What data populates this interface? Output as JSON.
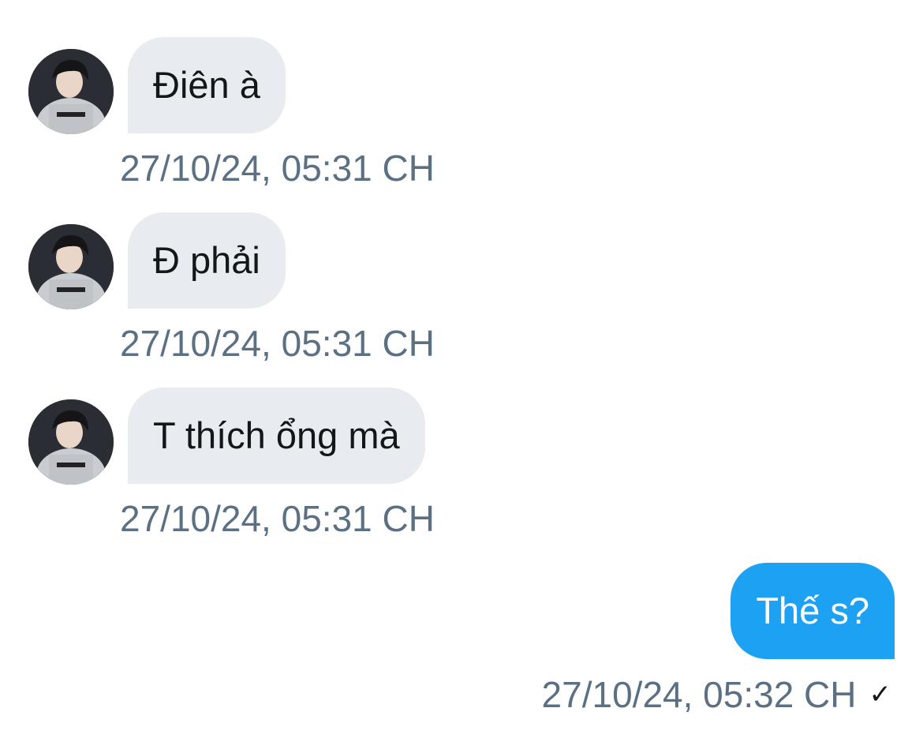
{
  "conversation": {
    "incoming": [
      {
        "text": "Điên à",
        "timestamp": "27/10/24, 05:31 CH",
        "avatar_icon": "user-avatar"
      },
      {
        "text": "Đ phải",
        "timestamp": "27/10/24, 05:31 CH",
        "avatar_icon": "user-avatar"
      },
      {
        "text": "T thích ổng mà",
        "timestamp": "27/10/24, 05:31 CH",
        "avatar_icon": "user-avatar"
      }
    ],
    "outgoing": [
      {
        "text": "Thế s?",
        "timestamp": "27/10/24, 05:32 CH",
        "status_icon": "checkmark-icon",
        "status_glyph": "✓"
      }
    ]
  },
  "colors": {
    "incoming_bubble": "#e8ecf0",
    "outgoing_bubble": "#1da1f2",
    "timestamp": "#5b7083"
  }
}
